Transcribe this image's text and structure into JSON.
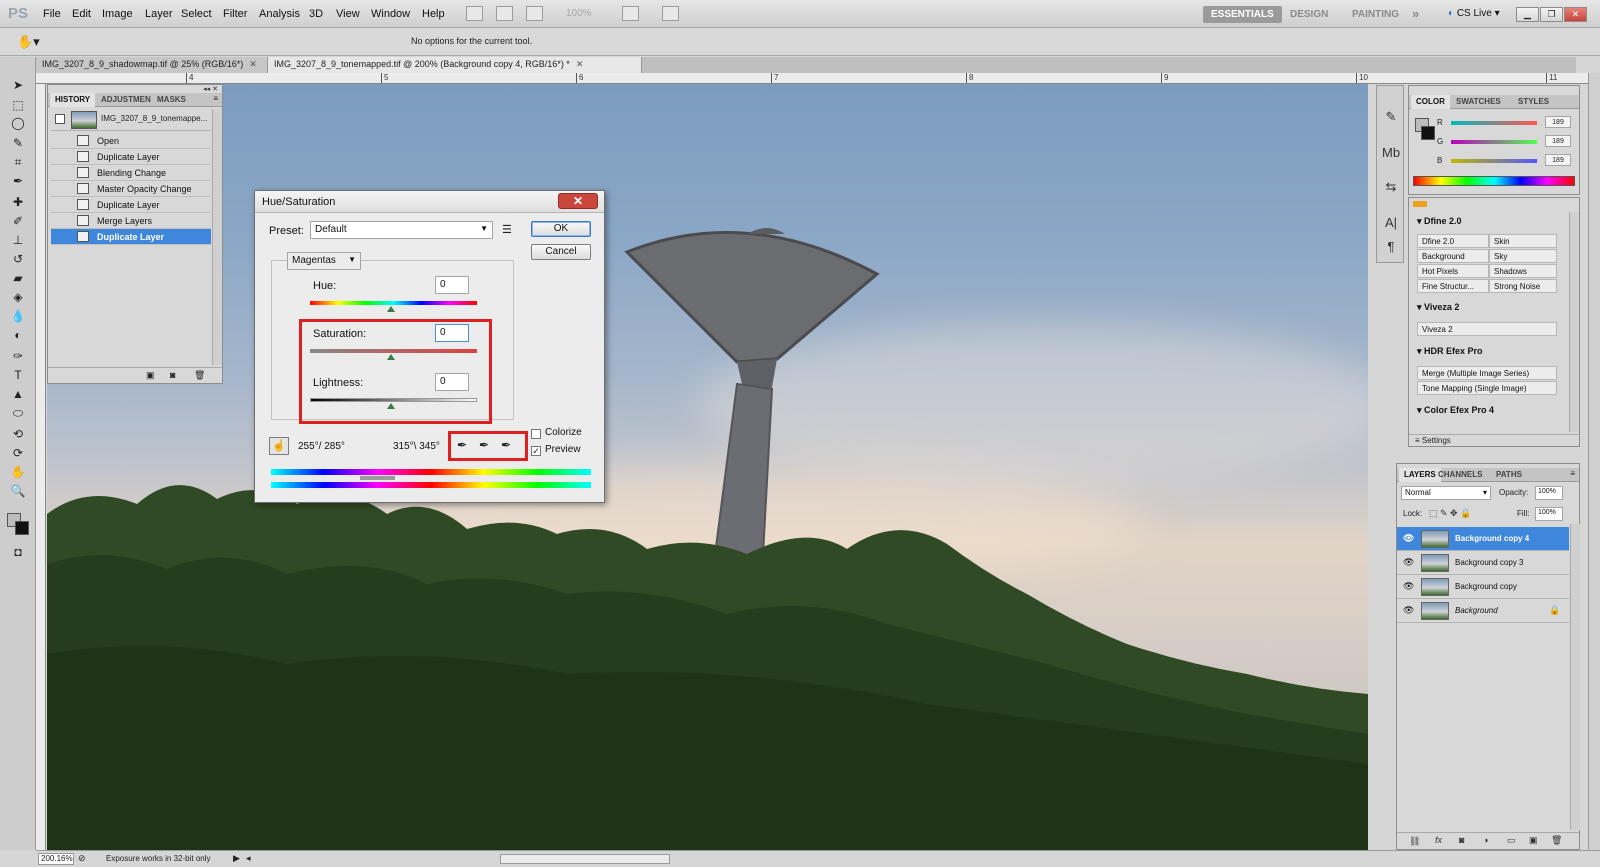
{
  "menubar": {
    "logo": "PS",
    "items": [
      "File",
      "Edit",
      "Image",
      "Layer",
      "Select",
      "Filter",
      "Analysis",
      "3D",
      "View",
      "Window",
      "Help"
    ],
    "zoom": "100%",
    "workspaces": [
      "ESSENTIALS",
      "DESIGN",
      "PAINTING"
    ],
    "more": "»",
    "cslive": "CS Live"
  },
  "options_bar": {
    "text": "No options for the current tool."
  },
  "doc_tabs": [
    "IMG_3207_8_9_shadowmap.tif @ 25% (RGB/16*)",
    "IMG_3207_8_9_tonemapped.tif @ 200% (Background copy 4, RGB/16*) *"
  ],
  "ruler_ticks": [
    "4",
    "5",
    "6",
    "7",
    "8",
    "9",
    "10",
    "11"
  ],
  "history": {
    "tabs": [
      "HISTORY",
      "ADJUSTMEN",
      "MASKS"
    ],
    "snapshot": "IMG_3207_8_9_tonemappe...",
    "items": [
      "Open",
      "Duplicate Layer",
      "Blending Change",
      "Master Opacity Change",
      "Duplicate Layer",
      "Merge Layers",
      "Duplicate Layer"
    ],
    "selected_index": 6
  },
  "huesat": {
    "title": "Hue/Saturation",
    "preset_label": "Preset:",
    "preset_value": "Default",
    "ok": "OK",
    "cancel": "Cancel",
    "channel": "Magentas",
    "hue_label": "Hue:",
    "hue_value": "0",
    "sat_label": "Saturation:",
    "sat_value": "0",
    "light_label": "Lightness:",
    "light_value": "0",
    "range_left": "255°/ 285°",
    "range_right": "315°\\ 345°",
    "colorize": "Colorize",
    "colorize_checked": false,
    "preview": "Preview",
    "preview_checked": true
  },
  "color_panel": {
    "tabs": [
      "COLOR",
      "SWATCHES",
      "STYLES"
    ],
    "channels": [
      {
        "name": "R",
        "value": "189"
      },
      {
        "name": "G",
        "value": "189"
      },
      {
        "name": "B",
        "value": "189"
      }
    ]
  },
  "nik_panel": {
    "sections": [
      {
        "title": "Dfine 2.0",
        "cells": [
          "Dfine 2.0",
          "Skin",
          "Background",
          "Sky",
          "Hot Pixels",
          "Shadows",
          "Fine Structur...",
          "Strong Noise"
        ]
      },
      {
        "title": "Viveza 2",
        "cells": [
          "Viveza 2"
        ]
      },
      {
        "title": "HDR Efex Pro",
        "cells": [
          "Merge (Multiple Image Series)",
          "Tone Mapping (Single Image)"
        ]
      },
      {
        "title": "Color Efex Pro 4",
        "cells": []
      }
    ],
    "settings": "Settings"
  },
  "layers_panel": {
    "tabs": [
      "LAYERS",
      "CHANNELS",
      "PATHS"
    ],
    "blend_mode": "Normal",
    "opacity_label": "Opacity:",
    "opacity": "100%",
    "lock_label": "Lock:",
    "fill_label": "Fill:",
    "fill": "100%",
    "layers": [
      "Background copy 4",
      "Background copy 3",
      "Background copy",
      "Background"
    ],
    "selected_index": 0
  },
  "status": {
    "zoom": "200.16%",
    "info": "Exposure works in 32-bit only"
  },
  "colors": {
    "selection_blue": "#3f86dd",
    "highlight_red": "#e02020"
  }
}
